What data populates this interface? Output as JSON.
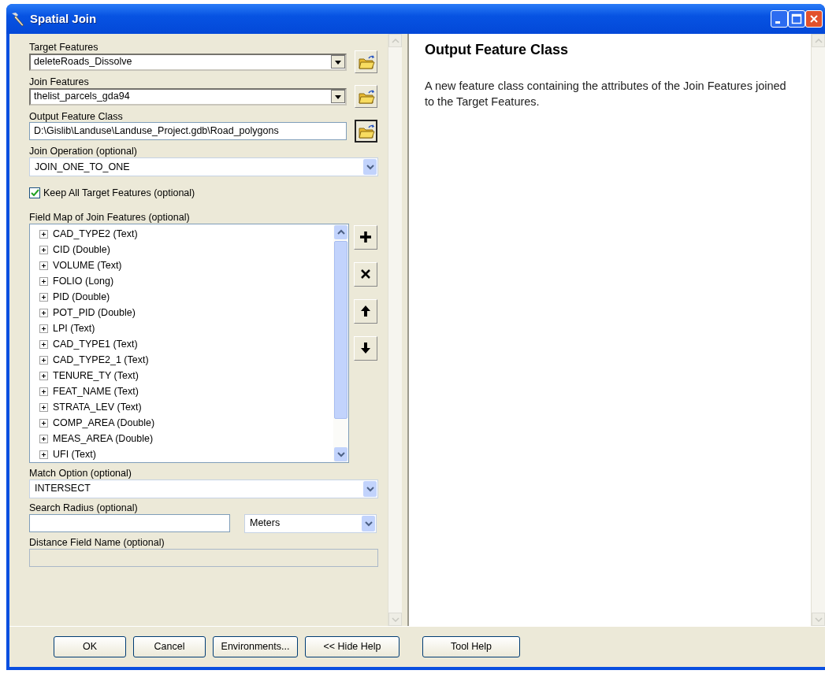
{
  "window": {
    "title": "Spatial Join"
  },
  "params": [
    {
      "kind": "combo",
      "label": "Target Features",
      "value": "deleteRoads_Dissolve"
    },
    {
      "kind": "combo",
      "label": "Join Features",
      "value": "thelist_parcels_gda94"
    },
    {
      "kind": "path",
      "label": "Output Feature Class",
      "value": "D:\\Gislib\\Landuse\\Landuse_Project.gdb\\Road_polygons"
    },
    {
      "kind": "select",
      "label": "Join Operation (optional)",
      "value": "JOIN_ONE_TO_ONE"
    },
    {
      "kind": "checkbox",
      "label": "Keep All Target Features (optional)",
      "checked": true
    },
    {
      "kind": "fieldmap",
      "label": "Field Map of Join Features (optional)",
      "fields": [
        {
          "label": "CAD_TYPE2 (Text)",
          "expanded": false
        },
        {
          "label": "CID (Double)",
          "expanded": false
        },
        {
          "label": "VOLUME (Text)",
          "expanded": false
        },
        {
          "label": "FOLIO (Long)",
          "expanded": false
        },
        {
          "label": "PID (Double)",
          "expanded": false
        },
        {
          "label": "POT_PID (Double)",
          "expanded": false
        },
        {
          "label": "LPI (Text)",
          "expanded": false
        },
        {
          "label": "CAD_TYPE1 (Text)",
          "expanded": false
        },
        {
          "label": "CAD_TYPE2_1 (Text)",
          "expanded": false
        },
        {
          "label": "TENURE_TY (Text)",
          "expanded": false
        },
        {
          "label": "FEAT_NAME (Text)",
          "expanded": false
        },
        {
          "label": "STRATA_LEV (Text)",
          "expanded": false
        },
        {
          "label": "COMP_AREA (Double)",
          "expanded": false
        },
        {
          "label": "MEAS_AREA (Double)",
          "expanded": false
        },
        {
          "label": "UFI (Text)",
          "expanded": false
        }
      ]
    },
    {
      "kind": "select",
      "label": "Match Option (optional)",
      "value": "INTERSECT"
    },
    {
      "kind": "radius",
      "label": "Search Radius (optional)",
      "unit": "Meters"
    },
    {
      "kind": "text",
      "label": "Distance Field Name (optional)",
      "disabled": true
    }
  ],
  "help": {
    "title": "Output Feature Class",
    "text": "A new feature class containing the attributes of the Join Features joined to the Target Features."
  },
  "buttons": [
    "OK",
    "Cancel",
    "Environments...",
    "<< Hide Help",
    "Tool Help"
  ]
}
